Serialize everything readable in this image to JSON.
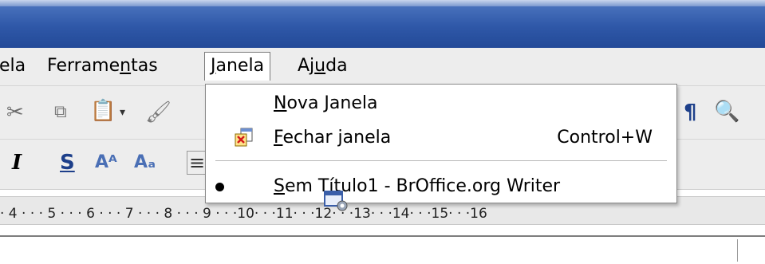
{
  "menubar": {
    "items": [
      {
        "prefix": "",
        "ul": "",
        "suffix": "ela",
        "name": "menu-formatar"
      },
      {
        "prefix": "Ferrame",
        "ul": "n",
        "suffix": "tas",
        "name": "menu-ferramentas"
      },
      {
        "prefix": "",
        "ul": "J",
        "suffix": "anela",
        "name": "menu-janela"
      },
      {
        "prefix": "Aj",
        "ul": "u",
        "suffix": "da",
        "name": "menu-ajuda"
      }
    ]
  },
  "dropdown": {
    "nova_janela": {
      "ul": "N",
      "rest": "ova Janela"
    },
    "fechar_janela": {
      "ul": "F",
      "rest": "echar janela",
      "accel": "Control+W"
    },
    "sem_titulo": {
      "ul": "S",
      "rest": "em Título1 - BrOffice.org Writer"
    }
  },
  "toolbar2": {
    "italic": "I",
    "strike": "S"
  },
  "ruler": {
    "text": "· 4 · · · 5 · · · 6 · · · 7 · · · 8 · · · 9 · · ·10· · ·11· · ·12· · ·13· · ·14· · ·15· · ·16"
  },
  "colors": {
    "titlebar": "#2f58a8",
    "menu_bg": "#ededed"
  }
}
